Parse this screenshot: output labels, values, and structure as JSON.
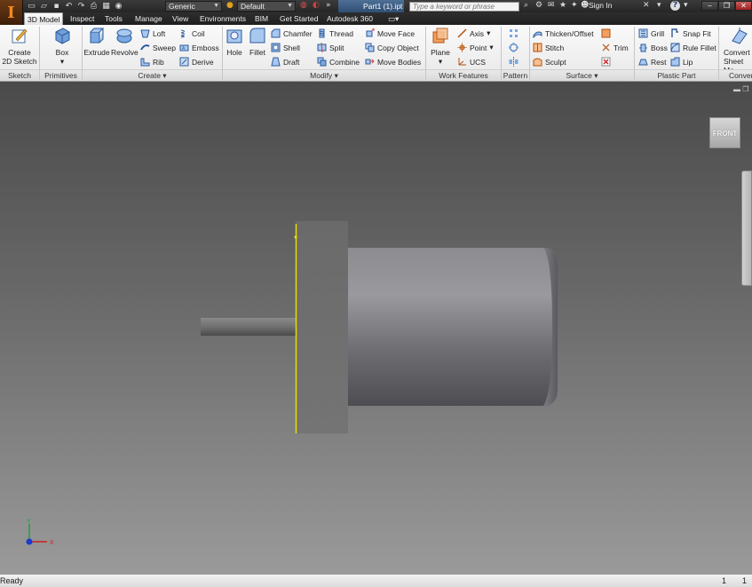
{
  "titlebar": {
    "logo": "I",
    "material": "Generic",
    "appearance": "Default",
    "document_tab": "Part1 (1).ipt",
    "search_placeholder": "Type a keyword or phrase",
    "sign_in": "Sign In",
    "help": "?"
  },
  "menu": {
    "tabs": [
      "3D Model",
      "Inspect",
      "Tools",
      "Manage",
      "View",
      "Environments",
      "BIM",
      "Get Started",
      "Autodesk 360"
    ],
    "active": "3D Model"
  },
  "ribbon": {
    "panels": {
      "sketch": "Sketch",
      "primitives": "Primitives",
      "create": "Create",
      "modify": "Modify",
      "work_features": "Work Features",
      "pattern": "Pattern",
      "surface": "Surface",
      "plastic_part": "Plastic Part",
      "convert": "Conver"
    },
    "sketch": {
      "create_2d_sketch_line1": "Create",
      "create_2d_sketch_line2": "2D Sketch"
    },
    "primitives": {
      "box": "Box"
    },
    "create": {
      "extrude": "Extrude",
      "revolve": "Revolve",
      "loft": "Loft",
      "sweep": "Sweep",
      "rib": "Rib",
      "coil": "Coil",
      "emboss": "Emboss",
      "derive": "Derive"
    },
    "modify": {
      "hole": "Hole",
      "fillet": "Fillet",
      "chamfer": "Chamfer",
      "shell": "Shell",
      "draft": "Draft",
      "thread": "Thread",
      "split": "Split",
      "combine": "Combine",
      "move_face": "Move Face",
      "copy_object": "Copy Object",
      "move_bodies": "Move Bodies"
    },
    "work_features": {
      "plane": "Plane",
      "axis": "Axis",
      "point": "Point",
      "ucs": "UCS"
    },
    "surface": {
      "thicken_offset": "Thicken/Offset",
      "stitch": "Stitch",
      "sculpt": "Sculpt",
      "trim": "Trim"
    },
    "plastic_part": {
      "grill": "Grill",
      "boss": "Boss",
      "rest": "Rest",
      "snap_fit": "Snap Fit",
      "rule_fillet": "Rule Fillet",
      "lip": "Lip"
    },
    "convert": {
      "line1": "Convert",
      "line2": "Sheet Me"
    }
  },
  "viewport": {
    "viewcube_face": "FRONT",
    "axis_x": "X",
    "axis_y": "Y",
    "edge_highlight_color": "#f0e000"
  },
  "statusbar": {
    "text": "Ready",
    "num1": "1",
    "num2": "1"
  }
}
